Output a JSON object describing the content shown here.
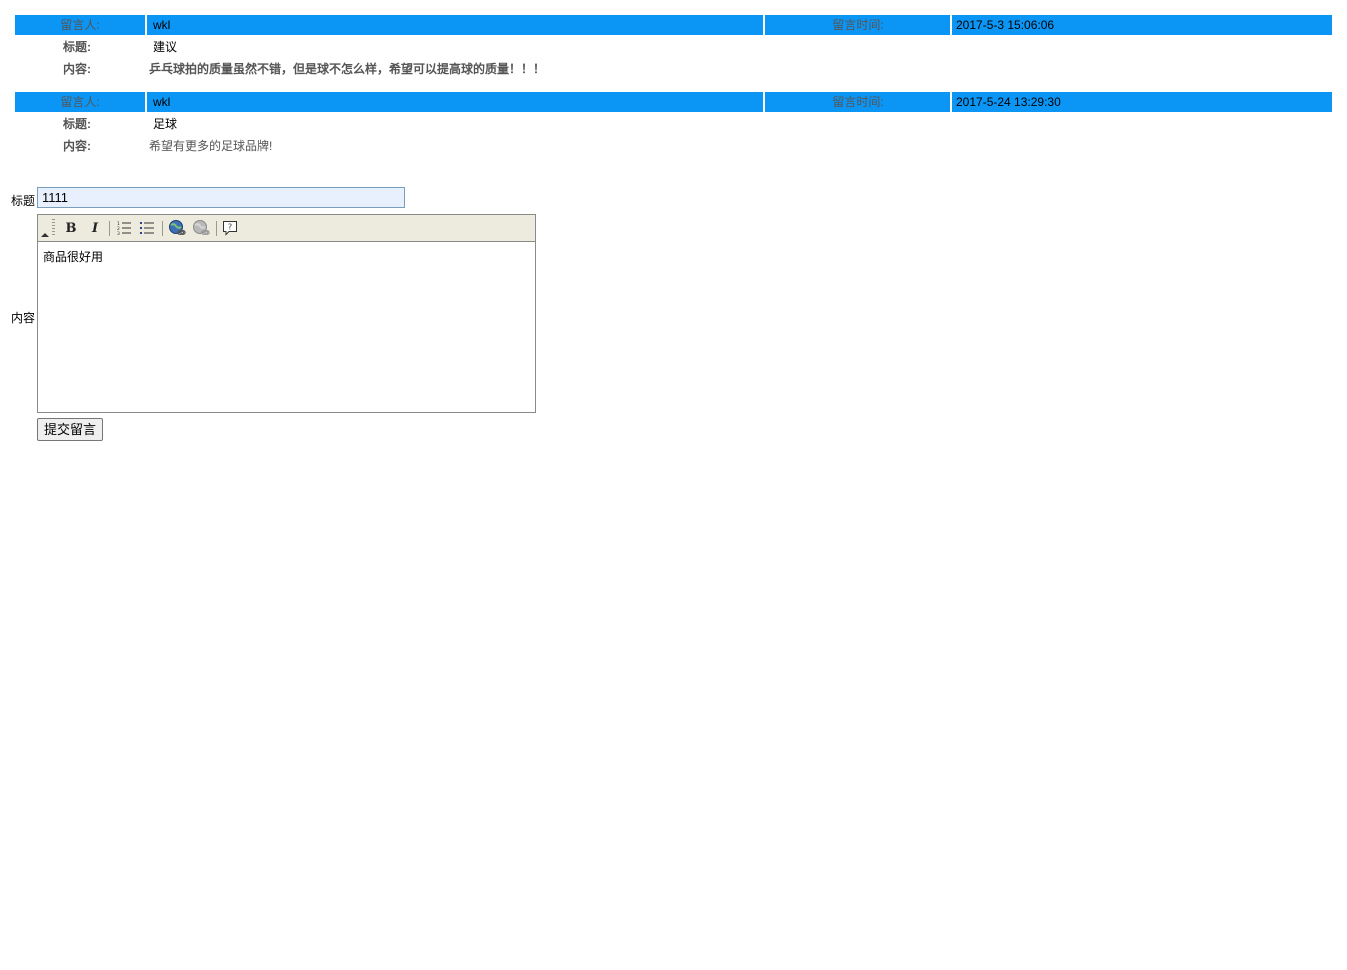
{
  "messages": [
    {
      "author_label": "留言人:",
      "author": "wkl",
      "time_label": "留言时间:",
      "time": "2017-5-3 15:06:06",
      "title_label": "标题:",
      "title": "建议",
      "content_label": "内容:",
      "content": "乒乓球拍的质量虽然不错，但是球不怎么样，希望可以提高球的质量！！！"
    },
    {
      "author_label": "留言人:",
      "author": "wkl",
      "time_label": "留言时间:",
      "time": "2017-5-24 13:29:30",
      "title_label": "标题:",
      "title": "足球",
      "content_label": "内容:",
      "content": "希望有更多的足球品牌!"
    }
  ],
  "form": {
    "title_label": "标题",
    "title_value": "1111",
    "content_label": "内容",
    "content_value": "商品很好用",
    "submit_label": "提交留言"
  },
  "colors": {
    "header_bg": "#0b96f5",
    "label_text": "#555555"
  },
  "toolbar": {
    "icons": [
      "bold-icon",
      "italic-icon",
      "ordered-list-icon",
      "unordered-list-icon",
      "insert-link-icon",
      "remove-link-icon",
      "help-icon"
    ]
  }
}
